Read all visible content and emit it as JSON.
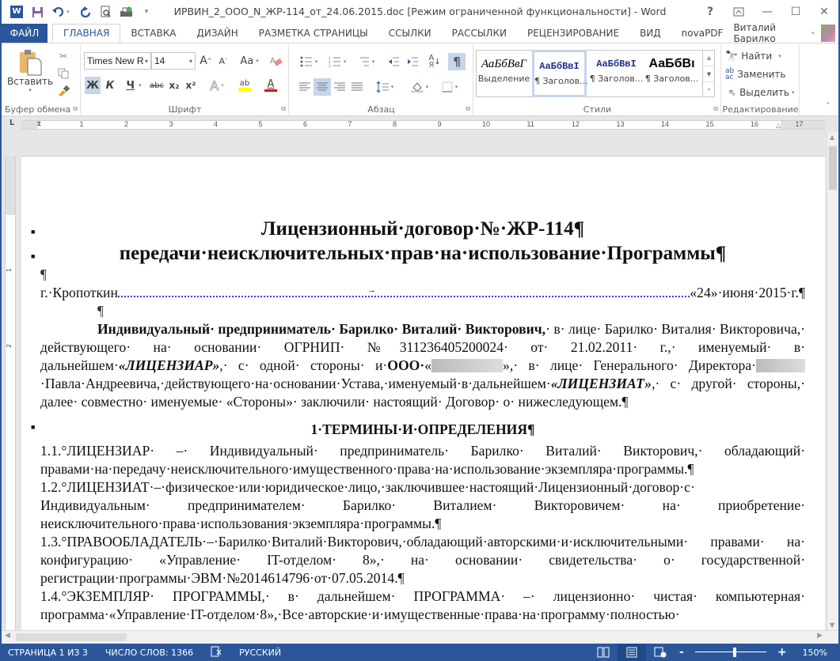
{
  "titlebar": {
    "title": "ИРВИН_2_ООО_N_ЖР-114_от_24.06.2015.doc [Режим ограниченной функциональности] - Word",
    "quick_access": [
      {
        "name": "word-logo-icon",
        "glyph": "W"
      },
      {
        "name": "save-icon",
        "glyph": "💾"
      },
      {
        "name": "undo-icon",
        "glyph": "↶▾"
      },
      {
        "name": "redo-icon",
        "glyph": "↻"
      },
      {
        "name": "print-preview-icon",
        "glyph": "🔍"
      },
      {
        "name": "print-icon",
        "glyph": "🖨"
      },
      {
        "name": "customize-qat-icon",
        "glyph": "⩦"
      }
    ],
    "window_controls": {
      "help": "?",
      "ribbon_display": "⊼",
      "minimize": "—",
      "maximize": "☐",
      "close": "✕"
    }
  },
  "tabs": {
    "file": "ФАЙЛ",
    "items": [
      "ГЛАВНАЯ",
      "ВСТАВКА",
      "ДИЗАЙН",
      "РАЗМЕТКА СТРАНИЦЫ",
      "ССЫЛКИ",
      "РАССЫЛКИ",
      "РЕЦЕНЗИРОВАНИЕ",
      "ВИД",
      "novaPDF"
    ],
    "active": "ГЛАВНАЯ",
    "user_name": "Виталий Барилко"
  },
  "ribbon": {
    "clipboard": {
      "label": "Буфер обмена",
      "paste": "Вставить"
    },
    "font": {
      "label": "Шрифт",
      "font_name": "Times New R",
      "font_size": "14",
      "grow": "A˄",
      "shrink": "A˅",
      "change_case": "Aa",
      "bold": "Ж",
      "italic": "К",
      "underline": "Ч",
      "strike": "abc",
      "subscript": "x₂",
      "superscript": "x²",
      "text_effects": "A",
      "highlight": "ab",
      "font_color": "A",
      "highlight_color": "#ffff00",
      "font_color_value": "#e00000"
    },
    "paragraph": {
      "label": "Абзац",
      "pilcrow": "¶"
    },
    "styles": {
      "label": "Стили",
      "items": [
        {
          "sample": "АаБбВвГ",
          "name": "Выделение"
        },
        {
          "sample": "АаБбВвI",
          "name": "¶ Заголов..."
        },
        {
          "sample": "АаБбВвI",
          "name": "¶ Заголов..."
        },
        {
          "sample": "АаБбВı",
          "name": "¶ Заголов..."
        }
      ]
    },
    "editing": {
      "label": "Редактирование",
      "find": "Найти",
      "replace": "Заменить",
      "select": "Выделить"
    }
  },
  "ruler": {
    "corner": "L",
    "numbers": [
      "1",
      "2",
      "3",
      "4",
      "5",
      "6",
      "7",
      "8",
      "9",
      "10",
      "11",
      "12",
      "13",
      "14",
      "15",
      "16",
      "17"
    ],
    "vnumbers": [
      "1",
      "2"
    ]
  },
  "document": {
    "title1": "Лицензионный·договор·№·ЖР-114¶",
    "title2": "передачи·неисключительных·прав·на·использование·Программы¶",
    "empty_para": "¶",
    "city": "г.·Кропоткин",
    "date": "«24»·июня·2015·г.¶",
    "intro": {
      "bold_start": "Индивидуальный· предприниматель· Барилко· Виталий· Викторович,",
      "text1": "· в· лице· Барилко· Виталия· Викторовича,· действующего· на· основании· ОГРНИП· №311236405200024· от· 21.02.2011· г.,· именуемый· в· дальнейшем·",
      "licensor": "«ЛИЦЕНЗИАР»",
      "text2": ",· с· одной· стороны· и·",
      "ooo": "ООО·",
      "quote_open": "«",
      "text3": "»,· в· лице· Генерального· Директора·",
      "text4": "·Павла·Андреевича,·действующего·на·основании·Устава,·именуемый·в·дальнейшем·",
      "licensee": "«ЛИЦЕНЗИАТ»",
      "text5": ",· с· другой· стороны,· далее· совместно· именуемые· «Стороны»· заключили· настоящий· Договор· о· нижеследующем.¶"
    },
    "section1": "1·ТЕРМИНЫ·И·ОПРЕДЕЛЕНИЯ¶",
    "items": [
      "1.1.°ЛИЦЕНЗИАР· –· Индивидуальный· предприниматель· Барилко· Виталий· Викторович,· обладающий· правами·на·передачу·неисключительного·имущественного·права·на·использование·экземпляра·программы.¶",
      "1.2.°ЛИЦЕНЗИАТ·–·физическое·или·юридическое·лицо,·заключившее·настоящий·Лицензионный·договор·с· Индивидуальным· предпринимателем· Барилко· Виталием· Викторовичем· на· приобретение· неисключительного·права·использования·экземпляра·программы.¶",
      "1.3.°ПРАВООБЛАДАТЕЛЬ·–·Барилко·Виталий·Викторович,·обладающий·авторскими·и·исключительными· правами· на· конфигурацию· «Управление· IT-отделом· 8»,· на· основании· свидетельства· о· государственной· регистрации·программы·ЭВМ·№2014614796·от·07.05.2014.¶",
      "1.4.°ЭКЗЕМПЛЯР· ПРОГРАММЫ,· в· дальнейшем· ПРОГРАММА· –· лицензионно· чистая· компьютерная· программа·«Управление·IT-отделом·8»,·Все·авторские·и·имущественные·права·на·программу·полностью·"
    ]
  },
  "statusbar": {
    "page": "СТРАНИЦА 1 ИЗ 3",
    "words": "ЧИСЛО СЛОВ: 1366",
    "proofing_icon": "📖",
    "language": "РУССКИЙ",
    "zoom_label": "150%",
    "zoom_percent": 150,
    "zoom_minus": "-",
    "zoom_plus": "+"
  }
}
